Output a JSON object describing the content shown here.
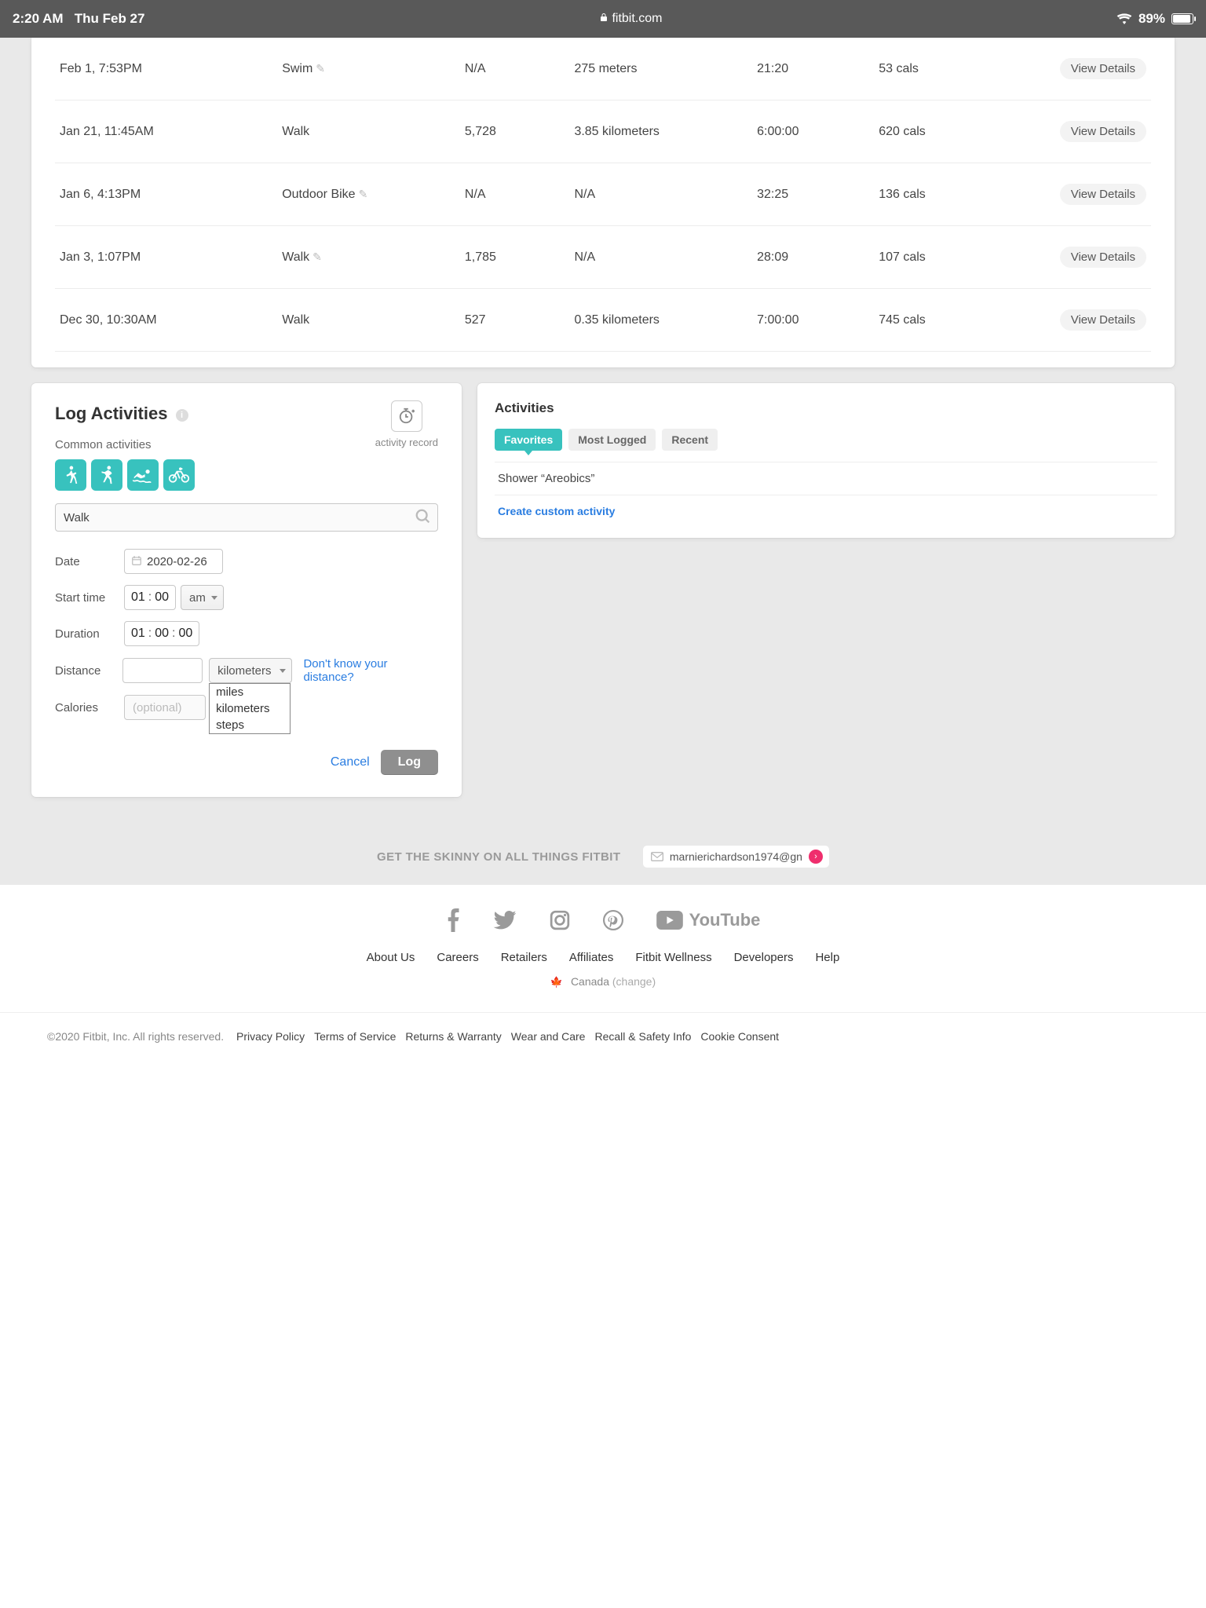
{
  "status": {
    "time": "2:20 AM",
    "date": "Thu Feb 27",
    "domain": "fitbit.com",
    "battery": "89%"
  },
  "activities": [
    {
      "date": "Feb 1, 7:53PM",
      "name": "Swim",
      "editable": true,
      "steps": "N/A",
      "distance": "275 meters",
      "duration": "21:20",
      "calories": "53 cals",
      "button": "View Details"
    },
    {
      "date": "Jan 21, 11:45AM",
      "name": "Walk",
      "editable": false,
      "steps": "5,728",
      "distance": "3.85 kilometers",
      "duration": "6:00:00",
      "calories": "620 cals",
      "button": "View Details"
    },
    {
      "date": "Jan 6, 4:13PM",
      "name": "Outdoor Bike",
      "editable": true,
      "steps": "N/A",
      "distance": "N/A",
      "duration": "32:25",
      "calories": "136 cals",
      "button": "View Details"
    },
    {
      "date": "Jan 3, 1:07PM",
      "name": "Walk",
      "editable": true,
      "steps": "1,785",
      "distance": "N/A",
      "duration": "28:09",
      "calories": "107 cals",
      "button": "View Details"
    },
    {
      "date": "Dec 30, 10:30AM",
      "name": "Walk",
      "editable": false,
      "steps": "527",
      "distance": "0.35 kilometers",
      "duration": "7:00:00",
      "calories": "745 cals",
      "button": "View Details"
    }
  ],
  "log": {
    "title": "Log Activities",
    "record_label": "activity record",
    "common_label": "Common activities",
    "search_value": "Walk",
    "labels": {
      "date": "Date",
      "start": "Start time",
      "duration": "Duration",
      "distance": "Distance",
      "calories": "Calories"
    },
    "date_value": "2020-02-26",
    "start": {
      "hh": "01",
      "mm": "00",
      "ampm": "am"
    },
    "duration": {
      "hh": "01",
      "mm": "00",
      "ss": "00"
    },
    "distance_value": "",
    "unit_selected": "kilometers",
    "unit_options": [
      "miles",
      "kilometers",
      "steps"
    ],
    "distance_link": "Don't know your distance?",
    "calories_placeholder": "(optional)",
    "cancel": "Cancel",
    "submit": "Log"
  },
  "side": {
    "title": "Activities",
    "tabs": [
      "Favorites",
      "Most Logged",
      "Recent"
    ],
    "active_tab": 0,
    "favorites": [
      "Shower “Areobics”"
    ],
    "create": "Create custom activity"
  },
  "newsletter": {
    "text": "GET THE SKINNY ON ALL THINGS FITBIT",
    "email": "marnierichardson1974@gn"
  },
  "footer": {
    "links": [
      "About Us",
      "Careers",
      "Retailers",
      "Affiliates",
      "Fitbit Wellness",
      "Developers",
      "Help"
    ],
    "region": "Canada",
    "change": "(change)",
    "copyright": "©2020 Fitbit, Inc. All rights reserved.",
    "legal_links": [
      "Privacy Policy",
      "Terms of Service",
      "Returns & Warranty",
      "Wear and Care",
      "Recall & Safety Info",
      "Cookie Consent"
    ]
  }
}
